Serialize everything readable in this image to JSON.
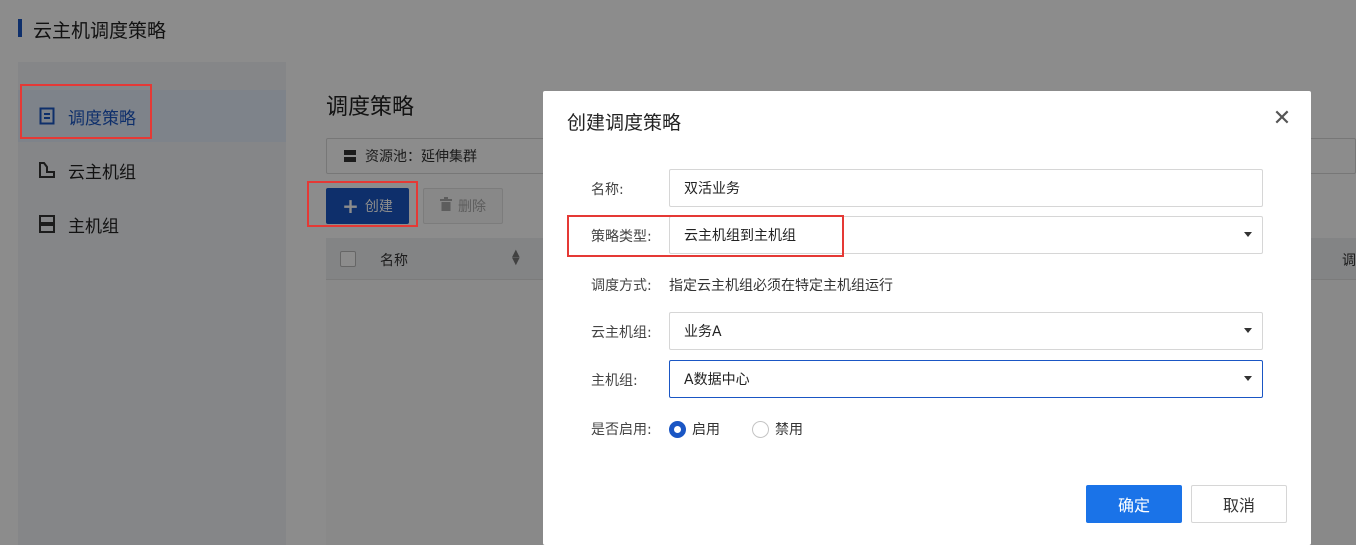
{
  "page": {
    "title": "云主机调度策略"
  },
  "sidebar": {
    "items": [
      {
        "label": "调度策略",
        "icon": "policy-doc-icon",
        "active": true
      },
      {
        "label": "云主机组",
        "icon": "vm-group-icon",
        "active": false
      },
      {
        "label": "主机组",
        "icon": "host-group-icon",
        "active": false
      }
    ]
  },
  "main": {
    "title": "调度策略",
    "resource_pool": "资源池：延伸集群",
    "create_label": "创建",
    "delete_label": "删除",
    "table": {
      "columns": [
        "名称",
        "调"
      ]
    }
  },
  "dialog": {
    "title": "创建调度策略",
    "fields": {
      "name": {
        "label": "名称:",
        "value": "双活业务"
      },
      "policy_type": {
        "label": "策略类型:",
        "value": "云主机组到主机组"
      },
      "schedule_mode": {
        "label": "调度方式:",
        "value": "指定云主机组必须在特定主机组运行"
      },
      "vm_group": {
        "label": "云主机组:",
        "value": "业务A"
      },
      "host_group": {
        "label": "主机组:",
        "value": "A数据中心"
      },
      "enabled": {
        "label": "是否启用:",
        "options": [
          "启用",
          "禁用"
        ],
        "selected": "启用"
      }
    },
    "ok_label": "确定",
    "cancel_label": "取消"
  },
  "colors": {
    "accent": "#1a56c4",
    "primary_button": "#1a73e8",
    "highlight": "#e53935"
  }
}
